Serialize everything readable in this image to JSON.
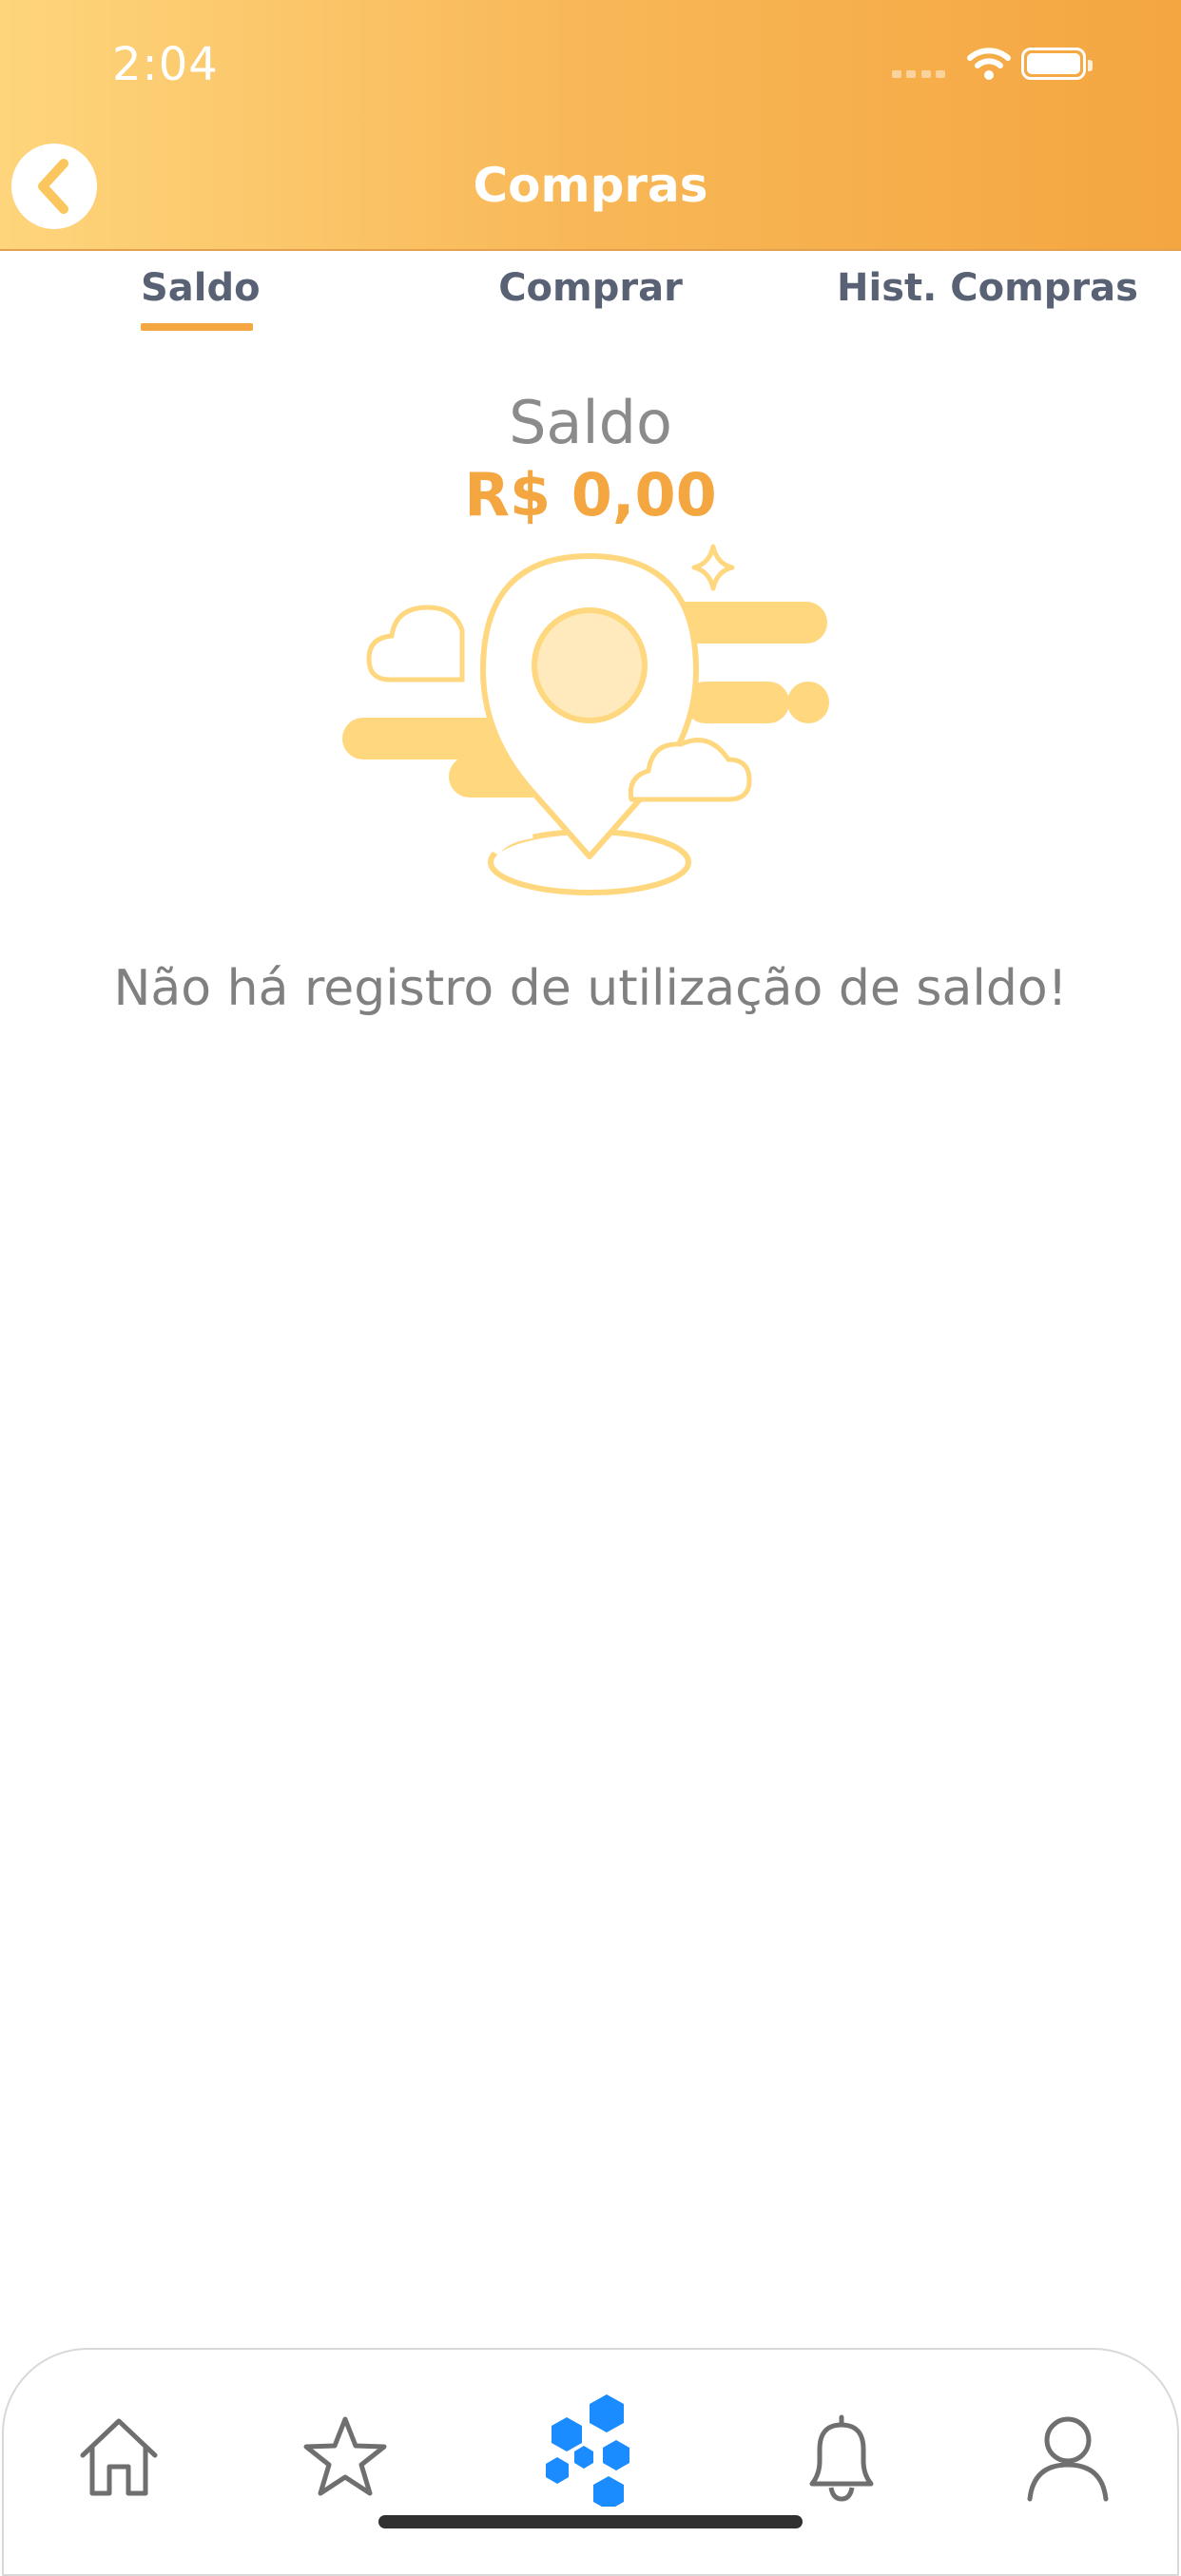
{
  "status_bar": {
    "time": "2:04"
  },
  "header": {
    "title": "Compras",
    "back_icon": "chevron-left-icon"
  },
  "tabs": [
    {
      "label": "Saldo",
      "active": true
    },
    {
      "label": "Comprar",
      "active": false
    },
    {
      "label": "Hist. Compras",
      "active": false
    }
  ],
  "balance": {
    "label": "Saldo",
    "value": "R$ 0,00"
  },
  "empty_state": {
    "illustration": "map-pin-clouds-illustration",
    "message": "Não há registro de utilização de saldo!"
  },
  "bottom_nav": [
    {
      "icon": "home-icon"
    },
    {
      "icon": "star-icon"
    },
    {
      "icon": "hexagon-cluster-icon"
    },
    {
      "icon": "bell-icon"
    },
    {
      "icon": "user-icon"
    }
  ],
  "colors": {
    "accent": "#f4a641",
    "header_gradient_start": "#fed57c",
    "header_gradient_end": "#f4a641",
    "illustration": "#fed77e",
    "tab_text": "#596274",
    "muted_text": "#808080",
    "center_nav": "#1a8cff"
  }
}
